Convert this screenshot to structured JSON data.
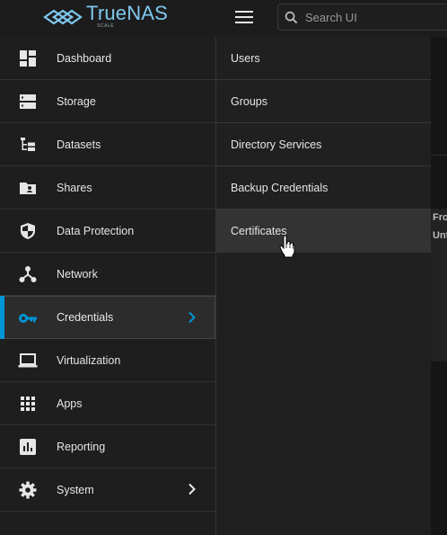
{
  "header": {
    "logo_title": "TrueNAS",
    "logo_sub": "SCALE",
    "menu_icon": "hamburger-icon",
    "search": {
      "placeholder": "Search UI",
      "value": "",
      "icon": "search-icon"
    }
  },
  "background": {
    "card_lines": [
      "Fro",
      "Unt"
    ]
  },
  "sidebar": {
    "items": [
      {
        "label": "Dashboard",
        "icon": "dashboard-icon"
      },
      {
        "label": "Storage",
        "icon": "storage-icon"
      },
      {
        "label": "Datasets",
        "icon": "datasets-icon"
      },
      {
        "label": "Shares",
        "icon": "shares-icon"
      },
      {
        "label": "Data Protection",
        "icon": "data-protection-icon"
      },
      {
        "label": "Network",
        "icon": "network-icon"
      },
      {
        "label": "Credentials",
        "icon": "credentials-icon",
        "active": true,
        "has_submenu": true
      },
      {
        "label": "Virtualization",
        "icon": "virtualization-icon"
      },
      {
        "label": "Apps",
        "icon": "apps-icon"
      },
      {
        "label": "Reporting",
        "icon": "reporting-icon"
      },
      {
        "label": "System",
        "icon": "system-icon",
        "has_submenu": true
      }
    ]
  },
  "submenu": {
    "items": [
      {
        "label": "Users"
      },
      {
        "label": "Groups"
      },
      {
        "label": "Directory Services"
      },
      {
        "label": "Backup Credentials"
      },
      {
        "label": "Certificates",
        "hovered": true
      }
    ]
  },
  "colors": {
    "accent": "#0095d5",
    "logo": "#7ec8ee",
    "sidebar_bg": "#1e1e1e",
    "submenu_bg": "#202020"
  }
}
